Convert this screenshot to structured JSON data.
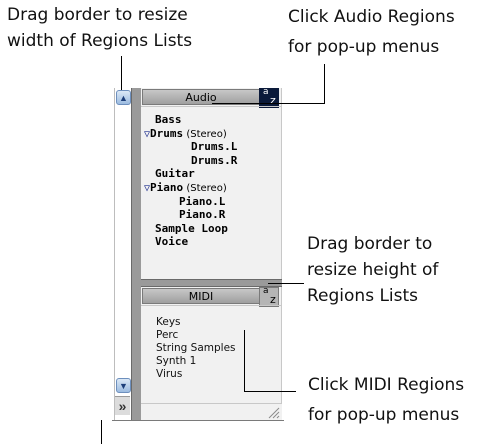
{
  "callouts": {
    "top_left": [
      "Drag border to resize",
      "width of Regions Lists"
    ],
    "top_right": [
      "Click Audio Regions",
      "for pop-up menus"
    ],
    "mid_right": [
      "Drag border to",
      "resize height of",
      "Regions Lists"
    ],
    "bottom_right": [
      "Click MIDI Regions",
      "for pop-up menus"
    ]
  },
  "audio": {
    "header": "Audio",
    "sort_glyph_top": "a",
    "sort_glyph_bottom": "z",
    "items": [
      {
        "name": "Bass",
        "suffix": "",
        "expanded": false,
        "indent": 0
      },
      {
        "name": "Drums",
        "suffix": " (Stereo)",
        "expanded": true,
        "indent": 0
      },
      {
        "name": "Drums.L",
        "suffix": "",
        "expanded": false,
        "indent": 2
      },
      {
        "name": "Drums.R",
        "suffix": "",
        "expanded": false,
        "indent": 2
      },
      {
        "name": "Guitar",
        "suffix": "",
        "expanded": false,
        "indent": 0
      },
      {
        "name": "Piano",
        "suffix": " (Stereo)",
        "expanded": true,
        "indent": 0
      },
      {
        "name": "Piano.L",
        "suffix": "",
        "expanded": false,
        "indent": 1
      },
      {
        "name": "Piano.R",
        "suffix": "",
        "expanded": false,
        "indent": 1
      },
      {
        "name": "Sample Loop",
        "suffix": "",
        "expanded": false,
        "indent": 0
      },
      {
        "name": "Voice",
        "suffix": "",
        "expanded": false,
        "indent": 0
      }
    ]
  },
  "midi": {
    "header": "MIDI",
    "sort_glyph_top": "a",
    "sort_glyph_bottom": "z",
    "items": [
      "Keys",
      "Perc",
      "String Samples",
      "Synth 1",
      "Virus"
    ]
  },
  "icons": {
    "scroll_up": "▲",
    "scroll_down": "▼",
    "expand_triangle": "▽",
    "show_hide": "»",
    "resize_grip": "resize-grip-icon"
  },
  "colors": {
    "scroll_button": "#9cbbe0",
    "header": "#b5b5b5",
    "list_background": "#f1f1f1"
  }
}
